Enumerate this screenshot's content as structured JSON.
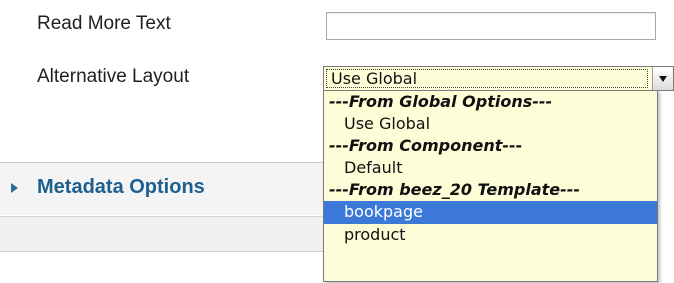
{
  "form": {
    "read_more_label": "Read More Text",
    "read_more_value": "",
    "alt_layout_label": "Alternative Layout",
    "alt_layout_selected": "Use Global"
  },
  "dropdown": {
    "rows": [
      {
        "type": "group",
        "label": "---From Global Options---"
      },
      {
        "type": "option",
        "label": "Use Global",
        "selected": false
      },
      {
        "type": "group",
        "label": "---From Component---"
      },
      {
        "type": "option",
        "label": "Default",
        "selected": false
      },
      {
        "type": "group",
        "label": "---From beez_20 Template---"
      },
      {
        "type": "option",
        "label": "bookpage",
        "selected": true
      },
      {
        "type": "option",
        "label": "product",
        "selected": false
      }
    ]
  },
  "panel": {
    "metadata_title": "Metadata Options"
  },
  "colors": {
    "select_bg": "#fdfdd8",
    "highlight": "#3c78d8",
    "panel_title": "#1e5f8f"
  },
  "icons": {
    "select_arrow": "chevron-down-icon",
    "panel_toggle": "triangle-right-icon"
  }
}
